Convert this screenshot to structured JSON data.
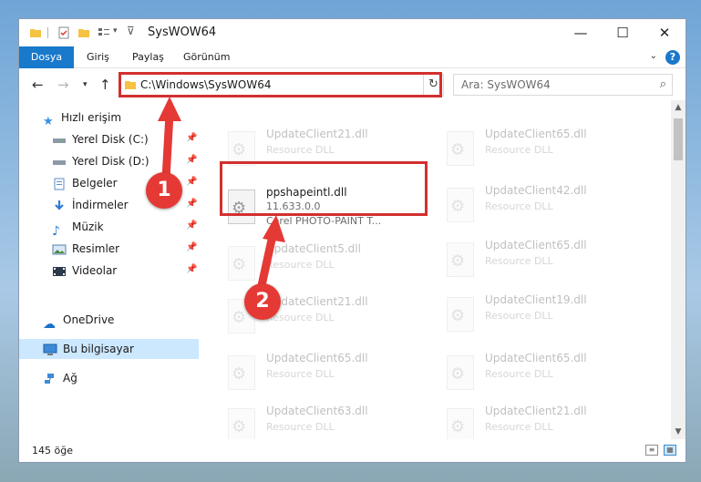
{
  "window": {
    "title": "SysWOW64"
  },
  "ribbon": {
    "tabs": [
      "Dosya",
      "Giriş",
      "Paylaş",
      "Görünüm"
    ],
    "active_tab": "Dosya",
    "help": "?"
  },
  "navigation": {
    "address": "C:\\Windows\\SysWOW64",
    "search_placeholder": "Ara: SysWOW64"
  },
  "sidebar": {
    "quick_access": "Hızlı erişim",
    "items": [
      {
        "label": "Yerel Disk (C:)",
        "icon": "drive-icon",
        "pinned": true
      },
      {
        "label": "Yerel Disk (D:)",
        "icon": "drive-icon",
        "pinned": true
      },
      {
        "label": "Belgeler",
        "icon": "documents-icon",
        "pinned": true
      },
      {
        "label": "İndirmeler",
        "icon": "downloads-icon",
        "pinned": true
      },
      {
        "label": "Müzik",
        "icon": "music-icon",
        "pinned": true
      },
      {
        "label": "Resimler",
        "icon": "pictures-icon",
        "pinned": true
      },
      {
        "label": "Videolar",
        "icon": "videos-icon",
        "pinned": true
      }
    ],
    "onedrive": "OneDrive",
    "this_pc": "Bu bilgisayar",
    "network": "Ağ"
  },
  "files": {
    "left_column": [
      {
        "name": "UpdateClient21.dll",
        "line1": "Resource DLL"
      },
      {
        "name": "ppshapeintl.dll",
        "line1": "11.633.0.0",
        "line2": "Corel PHOTO-PAINT T...",
        "selected": true
      },
      {
        "name": "UpdateClient5.dll",
        "line1": "Resource DLL"
      },
      {
        "name": "UpdateClient21.dll",
        "line1": "Resource DLL"
      },
      {
        "name": "UpdateClient65.dll",
        "line1": "Resource DLL"
      },
      {
        "name": "UpdateClient63.dll",
        "line1": "Resource DLL"
      },
      {
        "name": "",
        "line1": ""
      }
    ],
    "right_column": [
      {
        "name": "UpdateClient65.dll",
        "line1": "Resource DLL"
      },
      {
        "name": "UpdateClient42.dll",
        "line1": "Resource DLL"
      },
      {
        "name": "UpdateClient65.dll",
        "line1": "Resource DLL"
      },
      {
        "name": "UpdateClient19.dll",
        "line1": "Resource DLL"
      },
      {
        "name": "UpdateClient65.dll",
        "line1": "Resource DLL"
      },
      {
        "name": "UpdateClient21.dll",
        "line1": "Resource DLL"
      },
      {
        "name": "",
        "line1": ""
      }
    ]
  },
  "status": {
    "item_count": "145 öğe"
  },
  "annotations": {
    "badge1": "1",
    "badge2": "2",
    "color": "#d32f2f"
  },
  "colors": {
    "accent": "#1979ca",
    "selection": "#cce8ff"
  }
}
